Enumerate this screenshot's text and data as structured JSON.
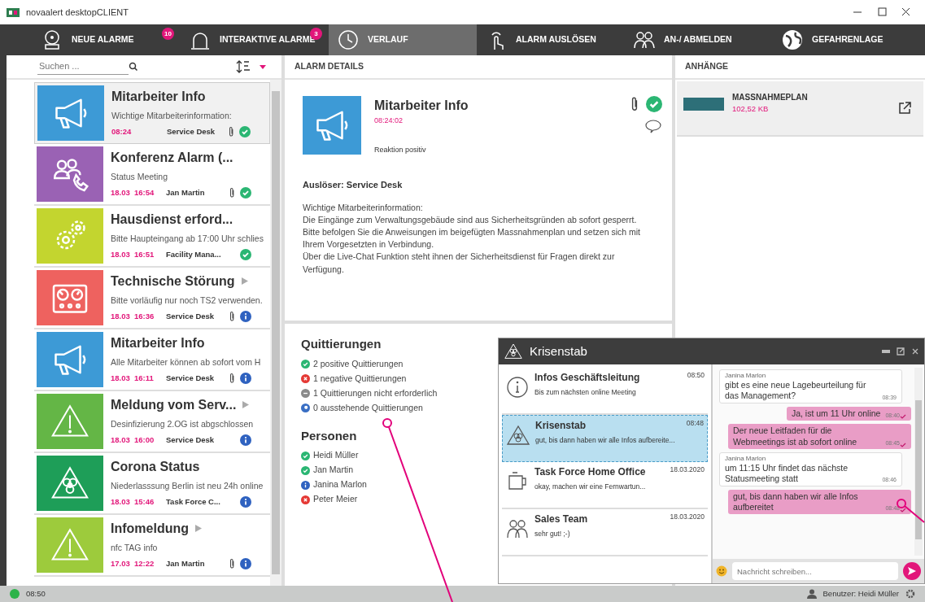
{
  "window": {
    "title": "novaalert desktopCLIENT"
  },
  "nav": [
    {
      "label": "NEUE ALARME",
      "badge": "10",
      "selected": false
    },
    {
      "label": "INTERAKTIVE ALARME",
      "badge": "3",
      "selected": false
    },
    {
      "label": "VERLAUF",
      "selected": true
    },
    {
      "label": "ALARM AUSLÖSEN",
      "selected": false
    },
    {
      "label": "AN-/ ABMELDEN",
      "selected": false
    },
    {
      "label": "GEFAHRENLAGE",
      "selected": false
    }
  ],
  "search": {
    "placeholder": "Suchen ..."
  },
  "alarms": [
    {
      "title": "Mitarbeiter Info",
      "text": "Wichtige Mitarbeiterinformation:",
      "date": "08:24",
      "author": "Service Desk",
      "kind": "megaphone",
      "color": "#3d9ad6",
      "attachment": true,
      "acknowledged": true,
      "more": false,
      "selected": true
    },
    {
      "title": "Konferenz Alarm (...",
      "text": "Status Meeting",
      "date": "18.03  16:54",
      "author": "Jan Martin",
      "kind": "conference",
      "color": "#9a62b4",
      "attachment": true,
      "acknowledged": true,
      "more": false,
      "selected": false
    },
    {
      "title": "Hausdienst erford...",
      "text": "Bitte Haupteingang ab 17:00 Uhr schlies",
      "date": "18.03  16:51",
      "author": "Facility Mana...",
      "kind": "gears",
      "color": "#c3d52f",
      "attachment": false,
      "acknowledged": true,
      "more": false,
      "selected": false
    },
    {
      "title": "Technische Störung",
      "text": "Bitte vorläufig nur noch TS2 verwenden.",
      "date": "18.03  16:36",
      "author": "Service Desk",
      "kind": "gauges",
      "color": "#ee625f",
      "attachment": true,
      "acknowledged": false,
      "more": true,
      "selected": false
    },
    {
      "title": "Mitarbeiter Info",
      "text": "Alle Mitarbeiter können ab sofort vom H",
      "date": "18.03  16:11",
      "author": "Service Desk",
      "kind": "megaphone",
      "color": "#3d9ad6",
      "attachment": true,
      "acknowledged": false,
      "more": false,
      "selected": false
    },
    {
      "title": "Meldung vom Serv...",
      "text": "Desinfizierung 2.OG ist abgschlossen",
      "date": "18.03  16:00",
      "author": "Service Desk",
      "kind": "warning",
      "color": "#64b646",
      "attachment": false,
      "acknowledged": false,
      "more": true,
      "selected": false
    },
    {
      "title": "Corona Status",
      "text": "Niederlasssung Berlin ist neu 24h online",
      "date": "18.03  15:46",
      "author": "Task Force C...",
      "kind": "biohazard",
      "color": "#1e9e58",
      "attachment": false,
      "acknowledged": false,
      "more": false,
      "selected": false
    },
    {
      "title": "Infomeldung",
      "text": "nfc TAG info",
      "date": "17.03  12:22",
      "author": "Jan Martin",
      "kind": "warning",
      "color": "#9dcb3c",
      "attachment": true,
      "acknowledged": false,
      "more": true,
      "selected": false
    }
  ],
  "details": {
    "header": "ALARM DETAILS",
    "title": "Mitarbeiter Info",
    "time": "08:24:02",
    "reaction": "Reaktion positiv",
    "kind": "megaphone",
    "color": "#3d9ad6",
    "attachment": true,
    "acknowledged": true,
    "trigger": "Auslöser: Service Desk",
    "body_lines": [
      "Wichtige Mitarbeiterinformation:",
      "Die Eingänge zum Verwaltungsgebäude sind aus Sicherheitsgründen ab sofort gesperrt.",
      "Bitte befolgen Sie die Anweisungen im beigefügten Massnahmenplan und setzen sich mit",
      "Ihrem Vorgesetzten in Verbindung.",
      "Über die Live-Chat Funktion steht ihnen der Sicherheitsdienst für Fragen direkt zur",
      "Verfügung."
    ]
  },
  "acknowledgements": {
    "title": "Quittierungen",
    "items": [
      {
        "kind": "positive",
        "text": "2 positive Quittierungen"
      },
      {
        "kind": "negative",
        "text": "1 negative Quittierungen"
      },
      {
        "kind": "not_required",
        "text": "1 Quittierungen nicht erforderlich"
      },
      {
        "kind": "pending",
        "text": "0 ausstehende Quittierungen"
      }
    ]
  },
  "persons": {
    "title": "Personen",
    "items": [
      {
        "kind": "positive",
        "name": "Heidi Müller"
      },
      {
        "kind": "positive",
        "name": "Jan Martin"
      },
      {
        "kind": "info",
        "name": "Janina Marlon"
      },
      {
        "kind": "negative",
        "name": "Peter Meier"
      }
    ]
  },
  "attachments": {
    "header": "ANHÄNGE",
    "items": [
      {
        "name": "MASSNAHMEPLAN",
        "size": "102,52 KB"
      }
    ]
  },
  "chat": {
    "title": "Krisenstab",
    "conversations": [
      {
        "name": "Infos Geschäftsleitung",
        "preview": "Bis zum nächsten online Meeting",
        "time": "08:50",
        "kind": "info",
        "selected": false
      },
      {
        "name": "Krisenstab",
        "preview": "gut, bis dann haben wir alle Infos aufbereite...",
        "time": "08:48",
        "kind": "biohazard",
        "selected": true
      },
      {
        "name": "Task Force Home Office",
        "preview": "okay, machen wir eine Fernwartun...",
        "time": "18.03.2020",
        "kind": "office",
        "selected": false
      },
      {
        "name": "Sales Team",
        "preview": "sehr gut! ;-)",
        "time": "18.03.2020",
        "kind": "people",
        "selected": false
      }
    ],
    "messages": [
      {
        "kind": "incoming",
        "sender": "Janina Marlon",
        "text": "gibt es eine neue Lagebeurteilung für das Management?",
        "time": "08:39"
      },
      {
        "kind": "outgoing",
        "text": "Ja, ist um 11 Uhr online",
        "time": "08:40",
        "read": true
      },
      {
        "kind": "outgoing",
        "text": "Der neue Leitfaden für die Webmeetings ist ab sofort online",
        "time": "08:45",
        "read": true
      },
      {
        "kind": "incoming",
        "sender": "Janina Marlon",
        "text": "um 11:15 Uhr findet das nächste Statusmeeting statt",
        "time": "08:46"
      },
      {
        "kind": "outgoing",
        "text": "gut, bis dann haben wir alle Infos aufbereitet",
        "time": "08:48",
        "read": true
      }
    ],
    "input": {
      "placeholder": "Nachricht schreiben..."
    }
  },
  "status_bar": {
    "online": true,
    "time": "08:50",
    "user": "Benutzer: Heidi Müller"
  }
}
